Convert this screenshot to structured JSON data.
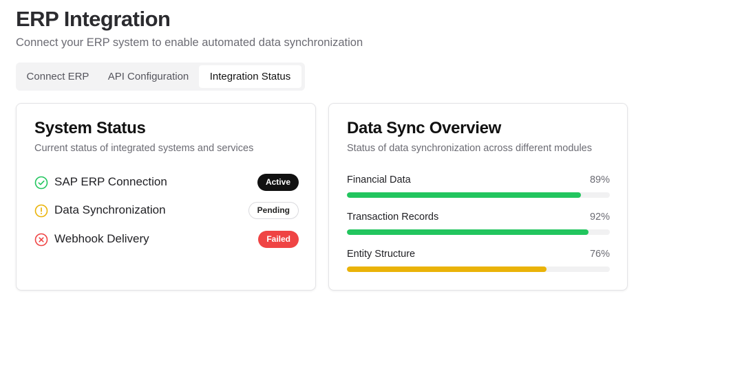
{
  "header": {
    "title": "ERP Integration",
    "subtitle": "Connect your ERP system to enable automated data synchronization"
  },
  "tabs": [
    {
      "label": "Connect ERP",
      "active": false
    },
    {
      "label": "API Configuration",
      "active": false
    },
    {
      "label": "Integration Status",
      "active": true
    }
  ],
  "system_status": {
    "title": "System Status",
    "description": "Current status of integrated systems and services",
    "items": [
      {
        "label": "SAP ERP Connection",
        "status": "Active",
        "icon": "check-circle-icon",
        "icon_color": "#22c55e"
      },
      {
        "label": "Data Synchronization",
        "status": "Pending",
        "icon": "alert-circle-icon",
        "icon_color": "#eab308"
      },
      {
        "label": "Webhook Delivery",
        "status": "Failed",
        "icon": "x-circle-icon",
        "icon_color": "#ef4444"
      }
    ]
  },
  "sync_overview": {
    "title": "Data Sync Overview",
    "description": "Status of data synchronization across different modules",
    "items": [
      {
        "label": "Financial Data",
        "percent_label": "89%",
        "percent": 89,
        "color": "#22c55e"
      },
      {
        "label": "Transaction Records",
        "percent_label": "92%",
        "percent": 92,
        "color": "#22c55e"
      },
      {
        "label": "Entity Structure",
        "percent_label": "76%",
        "percent": 76,
        "color": "#eab308"
      }
    ]
  }
}
